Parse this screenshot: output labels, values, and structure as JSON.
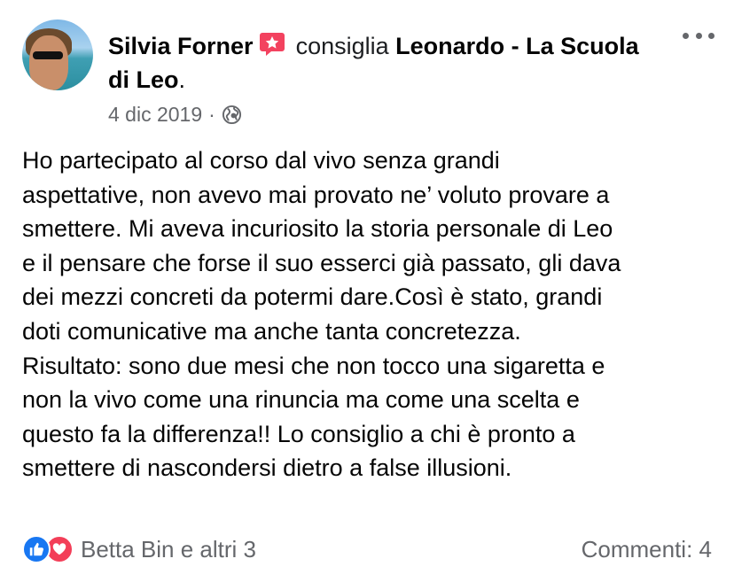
{
  "post": {
    "author": "Silvia Forner",
    "verb": "consiglia",
    "page_name": "Leonardo - La Scuola di Leo",
    "page_suffix": ".",
    "date": "4 dic 2019",
    "separator": "·",
    "privacy_icon": "globe-icon",
    "badge_icon": "recommend-star-icon",
    "more_icon": "more-options-icon",
    "body_lines": [
      "Ho partecipato al corso dal vivo senza grandi",
      "aspettative, non avevo mai provato ne’ voluto provare a",
      "smettere. Mi aveva incuriosito la storia personale di Leo",
      "e il pensare che forse il suo esserci già passato, gli  dava",
      "dei mezzi concreti da potermi dare.Così è stato, grandi",
      "doti comunicative ma anche tanta concretezza.",
      "Risultato: sono due mesi che non tocco una sigaretta e",
      "non la vivo come una rinuncia ma come una scelta e",
      "questo fa la differenza!! Lo consiglio a chi è pronto a",
      "smettere di nascondersi dietro a false illusioni."
    ]
  },
  "footer": {
    "reactions_text": "Betta Bin e altri 3",
    "reaction_icons": [
      "like-icon",
      "love-icon"
    ],
    "comments_text": "Commenti: 4"
  },
  "colors": {
    "text": "#050505",
    "secondary": "#65676b",
    "like": "#1877f2",
    "love": "#f33e58",
    "badge": "#f3425f"
  }
}
